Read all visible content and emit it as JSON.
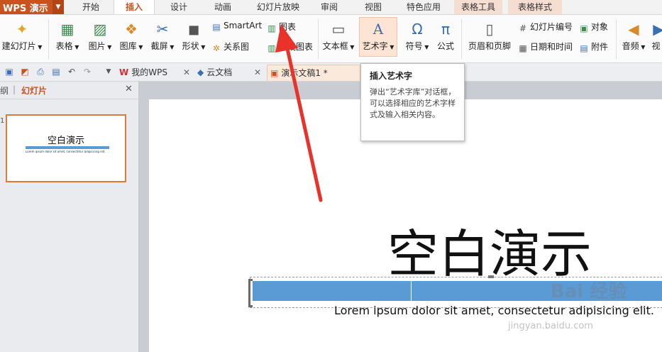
{
  "app": {
    "name": "WPS 演示"
  },
  "menu_tabs": [
    "开始",
    "插入",
    "设计",
    "动画",
    "幻灯片放映",
    "审阅",
    "视图",
    "特色应用",
    "表格工具",
    "表格样式"
  ],
  "ribbon": {
    "new_slide": "建幻灯片",
    "table": "表格",
    "picture": "图片",
    "gallery": "图库",
    "screenshot": "截屏",
    "shape": "形状",
    "smartart": "SmartArt",
    "chart": "图表",
    "relation": "关系图",
    "online_chart": "在线图表",
    "textbox": "文本框",
    "wordart": "艺术字",
    "symbol": "符号",
    "formula": "公式",
    "header_footer": "页眉和页脚",
    "slide_number": "幻灯片编号",
    "datetime": "日期和时间",
    "object": "对象",
    "attachment": "附件",
    "audio": "音频",
    "video": "视"
  },
  "doc_tabs": [
    {
      "label": "我的WPS"
    },
    {
      "label": "云文档"
    },
    {
      "label": "演示文稿1 *"
    }
  ],
  "left_panel": {
    "outline": "纲",
    "slides": "幻灯片",
    "slide_num": "1"
  },
  "slide": {
    "title": "空白演示",
    "subtitle": "Lorem ipsum dolor sit amet, consectetur adipisicing elit."
  },
  "tooltip": {
    "title": "插入艺术字",
    "body": "弹出“艺术字库”对话框，可以选择相应的艺术字样式及输入相关内容。"
  },
  "watermark": {
    "text": "Bai 经验",
    "url": "jingyan.baidu.com"
  },
  "colors": {
    "accent": "#c9531f",
    "table_bar": "#5b9bd5",
    "arrow": "#e8322a",
    "selection": "#e07a3a"
  }
}
